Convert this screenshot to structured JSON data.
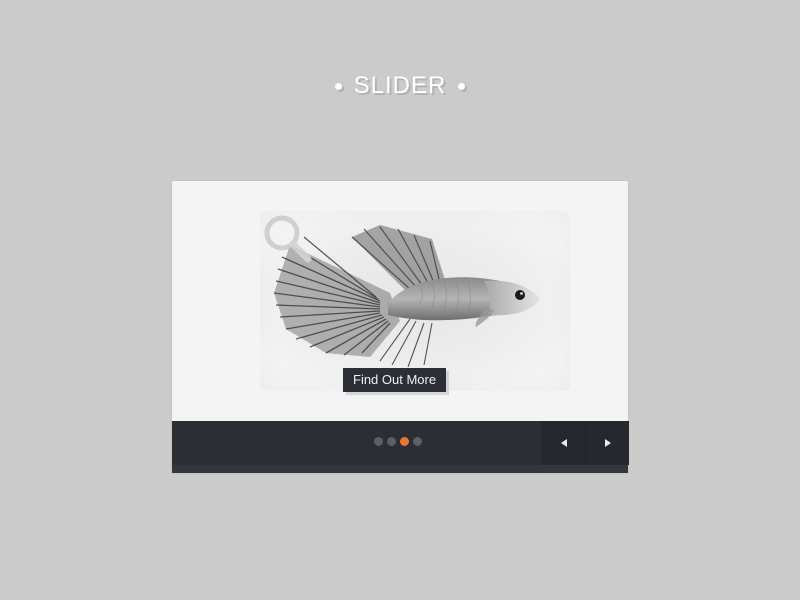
{
  "page": {
    "title": "SLIDER"
  },
  "slider": {
    "slide": {
      "image_subject": "betta-fish",
      "cta_label": "Find Out More"
    },
    "pager": {
      "count": 4,
      "active_index": 2
    },
    "controls": {
      "prev_icon": "triangle-left-icon",
      "next_icon": "triangle-right-icon"
    }
  },
  "colors": {
    "background": "#cbcbcb",
    "slide_bg": "#f4f4f4",
    "bar_bg": "#2b2e33",
    "nav_btn_bg": "#25282c",
    "accent": "#e8782f",
    "dot_inactive": "#5a5f68"
  }
}
